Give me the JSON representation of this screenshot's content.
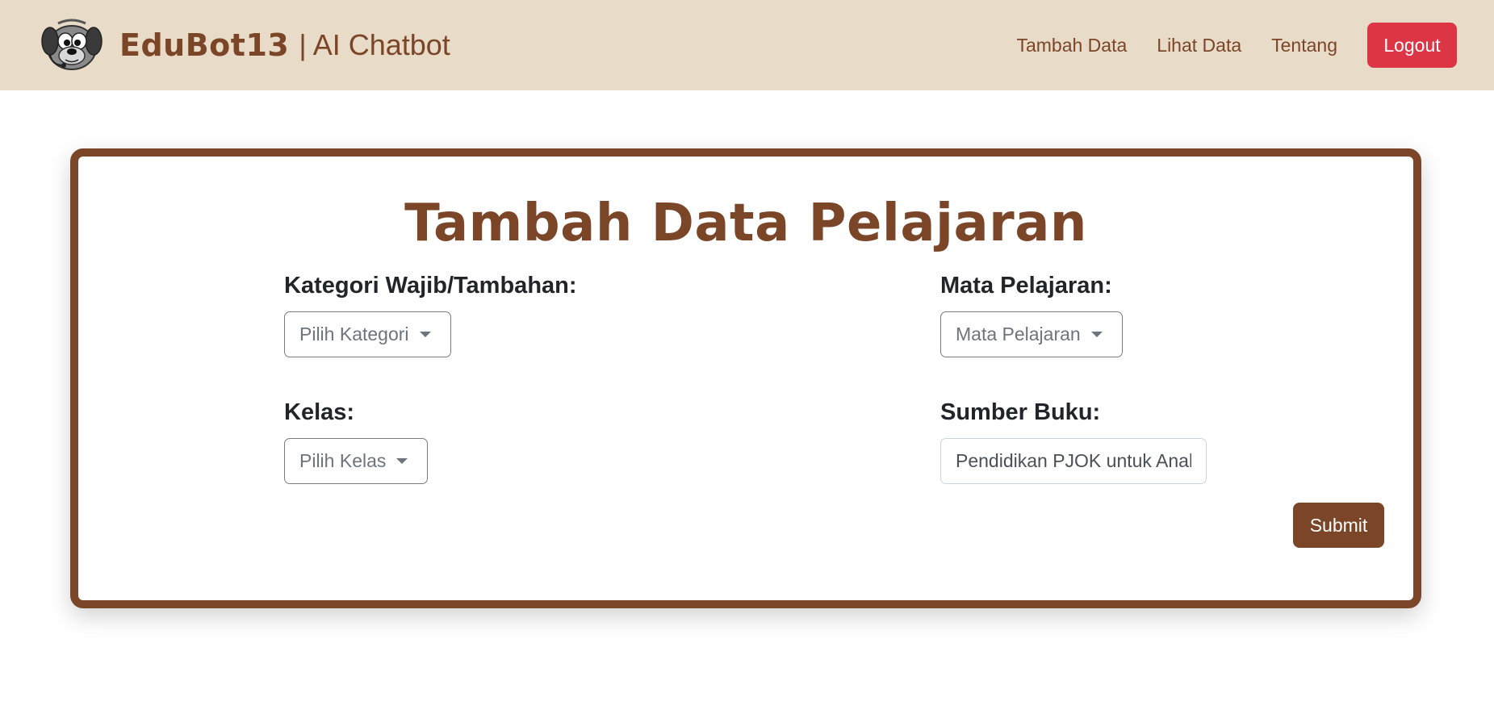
{
  "colors": {
    "brand_brown": "#7b4528",
    "navbar_bg": "#e8dcc8",
    "logout_red": "#dc3545"
  },
  "navbar": {
    "logo_icon": "cartoon-dog-headset-icon",
    "brand_name": "EduBot13",
    "brand_subtitle": "| AI Chatbot",
    "links": [
      "Tambah Data",
      "Lihat Data",
      "Tentang"
    ],
    "logout_label": "Logout"
  },
  "form": {
    "title": "Tambah Data Pelajaran",
    "kategori": {
      "label": "Kategori Wajib/Tambahan:",
      "selected": "Pilih Kategori"
    },
    "mapel": {
      "label": "Mata Pelajaran:",
      "selected": "Mata Pelajaran"
    },
    "kelas": {
      "label": "Kelas:",
      "selected": "Pilih Kelas"
    },
    "sumber": {
      "label": "Sumber Buku:",
      "value": "Pendidikan PJOK untuk Anak"
    },
    "submit_label": "Submit"
  }
}
